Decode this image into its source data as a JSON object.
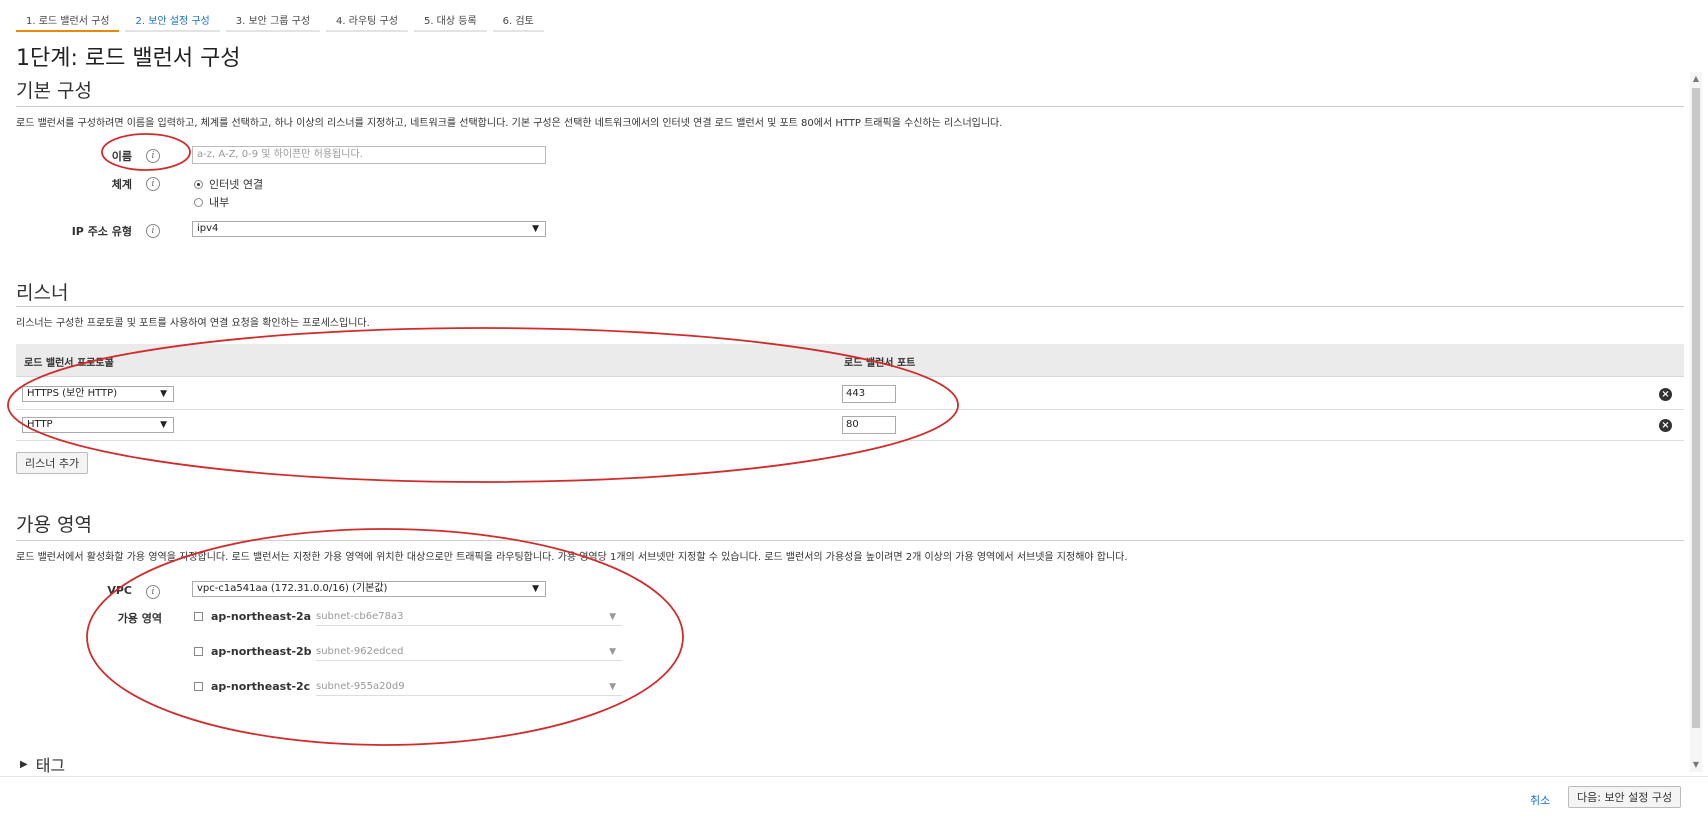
{
  "steps": [
    {
      "label": "1. 로드 밸런서 구성"
    },
    {
      "label": "2. 보안 설정 구성"
    },
    {
      "label": "3. 보안 그룹 구성"
    },
    {
      "label": "4. 라우팅 구성"
    },
    {
      "label": "5. 대상 등록"
    },
    {
      "label": "6. 검토"
    }
  ],
  "page_title": "1단계: 로드 밸런서 구성",
  "basic": {
    "title": "기본 구성",
    "description": "로드 밸런서를 구성하려면 이름을 입력하고, 체계를 선택하고, 하나 이상의 리스너를 지정하고, 네트워크를 선택합니다. 기본 구성은 선택한 네트워크에서의 인터넷 연결 로드 밸런서 및 포트 80에서 HTTP 트래픽을 수신하는 리스너입니다.",
    "name_label": "이름",
    "name_placeholder": "a-z, A-Z, 0-9 및 하이픈만 허용됩니다.",
    "scheme_label": "체계",
    "scheme_options": [
      "인터넷 연결",
      "내부"
    ],
    "ip_label": "IP 주소 유형",
    "ip_value": "ipv4"
  },
  "listeners": {
    "title": "리스너",
    "description": "리스너는 구성한 프로토콜 및 포트를 사용하여 연결 요청을 확인하는 프로세스입니다.",
    "col_protocol": "로드 밸런서 프로토콜",
    "col_port": "로드 밸런서 포트",
    "rows": [
      {
        "protocol": "HTTPS (보안 HTTP)",
        "port": "443"
      },
      {
        "protocol": "HTTP",
        "port": "80"
      }
    ],
    "add_button": "리스너 추가"
  },
  "az": {
    "title": "가용 영역",
    "description": "로드 밸런서에서 활성화할 가용 영역을 지정합니다. 로드 밸런서는 지정한 가용 영역에 위치한 대상으로만 트래픽을 라우팅합니다. 가용 영역당 1개의 서브넷만 지정할 수 있습니다. 로드 밸런서의 가용성을 높이려면 2개 이상의 가용 영역에서 서브넷을 지정해야 합니다.",
    "vpc_label": "VPC",
    "vpc_value": "vpc-c1a541aa (172.31.0.0/16) (기본값)",
    "zones_label": "가용 영역",
    "zones": [
      {
        "name": "ap-northeast-2a",
        "subnet": "subnet-cb6e78a3"
      },
      {
        "name": "ap-northeast-2b",
        "subnet": "subnet-962edced"
      },
      {
        "name": "ap-northeast-2c",
        "subnet": "subnet-955a20d9"
      }
    ]
  },
  "tags_label": "태그",
  "footer": {
    "cancel": "취소",
    "next": "다음: 보안 설정 구성"
  },
  "colors": {
    "accent_tab": "#e8890c",
    "link": "#1a6ec7",
    "annotation": "#d22b2b"
  }
}
